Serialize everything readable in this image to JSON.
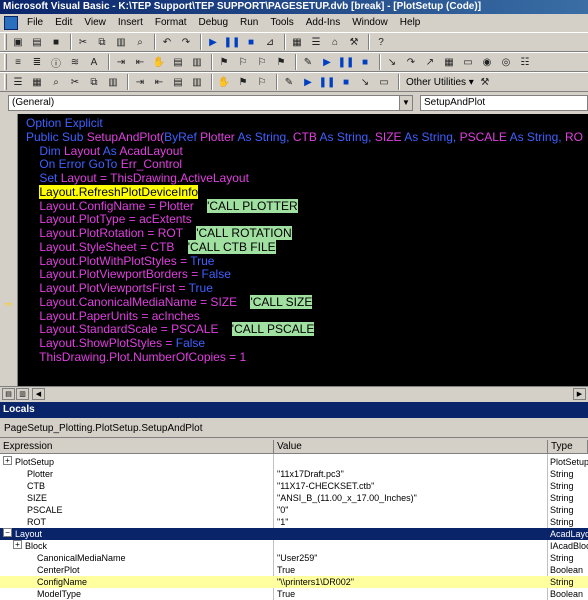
{
  "window": {
    "title": "Microsoft Visual Basic - K:\\TEP Support\\TEP SUPPORT\\PAGESETUP.dvb [break] - [PlotSetup (Code)]"
  },
  "menu": [
    "File",
    "Edit",
    "View",
    "Insert",
    "Format",
    "Debug",
    "Run",
    "Tools",
    "Add-Ins",
    "Window",
    "Help"
  ],
  "toolbar": {
    "other_utilities": "Other Utilities ▾"
  },
  "combos": {
    "object": "(General)",
    "procedure": "SetupAndPlot"
  },
  "code": {
    "lines": [
      [
        {
          "t": "Option Explicit",
          "c": "kw"
        }
      ],
      [
        {
          "t": "Public Sub ",
          "c": "kw"
        },
        {
          "t": "SetupAndPlot(",
          "c": "plain"
        },
        {
          "t": "ByRef ",
          "c": "kw"
        },
        {
          "t": "Plotter ",
          "c": "plain"
        },
        {
          "t": "As String, ",
          "c": "kw"
        },
        {
          "t": "CTB ",
          "c": "plain"
        },
        {
          "t": "As String, ",
          "c": "kw"
        },
        {
          "t": "SIZE ",
          "c": "plain"
        },
        {
          "t": "As String, ",
          "c": "kw"
        },
        {
          "t": "PSCALE ",
          "c": "plain"
        },
        {
          "t": "As String, ",
          "c": "kw"
        },
        {
          "t": "RO",
          "c": "plain"
        }
      ],
      [
        {
          "t": "    Dim ",
          "c": "kw"
        },
        {
          "t": "Layout ",
          "c": "plain"
        },
        {
          "t": "As ",
          "c": "kw"
        },
        {
          "t": "AcadLayout",
          "c": "plain"
        }
      ],
      [
        {
          "t": "    On Error GoTo ",
          "c": "kw"
        },
        {
          "t": "Err_Control",
          "c": "plain"
        }
      ],
      [
        {
          "t": "    Set ",
          "c": "kw"
        },
        {
          "t": "Layout = ThisDrawing.ActiveLayout",
          "c": "plain"
        }
      ],
      [
        {
          "t": "    ",
          "c": "plain"
        },
        {
          "t": "Layout.RefreshPlotDeviceInfo",
          "c": "hl"
        }
      ],
      [
        {
          "t": "    Layout.ConfigName = Plotter    ",
          "c": "plain"
        },
        {
          "t": "'CALL PLOTTER",
          "c": "cm"
        }
      ],
      [
        {
          "t": "    Layout.PlotType = acExtents",
          "c": "plain"
        }
      ],
      [
        {
          "t": "    Layout.PlotRotation = ROT    ",
          "c": "plain"
        },
        {
          "t": "'CALL ROTATION",
          "c": "cm"
        }
      ],
      [
        {
          "t": "    Layout.StyleSheet = CTB    ",
          "c": "plain"
        },
        {
          "t": "'CALL CTB FILE",
          "c": "cm"
        }
      ],
      [
        {
          "t": "    Layout.PlotWithPlotStyles = ",
          "c": "plain"
        },
        {
          "t": "True",
          "c": "kw"
        }
      ],
      [
        {
          "t": "    Layout.PlotViewportBorders = ",
          "c": "plain"
        },
        {
          "t": "False",
          "c": "kw"
        }
      ],
      [
        {
          "t": "    Layout.PlotViewportsFirst = ",
          "c": "plain"
        },
        {
          "t": "True",
          "c": "kw"
        }
      ],
      [
        {
          "t": "    Layout.CanonicalMediaName = SIZE    ",
          "c": "plain"
        },
        {
          "t": "'CALL SIZE",
          "c": "cm"
        }
      ],
      [
        {
          "t": "    Layout.PaperUnits = acInches",
          "c": "plain"
        }
      ],
      [
        {
          "t": "    Layout.StandardScale = PSCALE    ",
          "c": "plain"
        },
        {
          "t": "'CALL PSCALE",
          "c": "cm"
        }
      ],
      [
        {
          "t": "    Layout.ShowPlotStyles = ",
          "c": "plain"
        },
        {
          "t": "False",
          "c": "kw"
        }
      ],
      [
        {
          "t": "    ThisDrawing.Plot.NumberOfCopies = 1",
          "c": "plain"
        }
      ]
    ]
  },
  "locals": {
    "title": "Locals",
    "context": "PageSetup_Plotting.PlotSetup.SetupAndPlot",
    "columns": [
      "Expression",
      "Value",
      "Type"
    ],
    "rows": [
      {
        "expr": "PlotSetup",
        "value": "",
        "type": "PlotSetup",
        "expand": "+",
        "indent": 0,
        "style": ""
      },
      {
        "expr": "Plotter",
        "value": "\"11x17Draft.pc3\"",
        "type": "String",
        "expand": "",
        "indent": 1,
        "style": ""
      },
      {
        "expr": "CTB",
        "value": "\"11X17-CHECKSET.ctb\"",
        "type": "String",
        "expand": "",
        "indent": 1,
        "style": ""
      },
      {
        "expr": "SIZE",
        "value": "\"ANSI_B_(11.00_x_17.00_Inches)\"",
        "type": "String",
        "expand": "",
        "indent": 1,
        "style": ""
      },
      {
        "expr": "PSCALE",
        "value": "\"0\"",
        "type": "String",
        "expand": "",
        "indent": 1,
        "style": ""
      },
      {
        "expr": "ROT",
        "value": "\"1\"",
        "type": "String",
        "expand": "",
        "indent": 1,
        "style": ""
      },
      {
        "expr": "Layout",
        "value": "",
        "type": "AcadLayo",
        "expand": "−",
        "indent": 0,
        "style": "sel"
      },
      {
        "expr": "Block",
        "value": "",
        "type": "IAcadBlock",
        "expand": "+",
        "indent": 1,
        "style": ""
      },
      {
        "expr": "CanonicalMediaName",
        "value": "\"User259\"",
        "type": "String",
        "expand": "",
        "indent": 2,
        "style": ""
      },
      {
        "expr": "CenterPlot",
        "value": "True",
        "type": "Boolean",
        "expand": "",
        "indent": 2,
        "style": ""
      },
      {
        "expr": "ConfigName",
        "value": "\"\\\\printers1\\DR002\"",
        "type": "String",
        "expand": "",
        "indent": 2,
        "style": "yel"
      },
      {
        "expr": "ModelType",
        "value": "True",
        "type": "Boolean",
        "expand": "",
        "indent": 2,
        "style": ""
      }
    ]
  }
}
